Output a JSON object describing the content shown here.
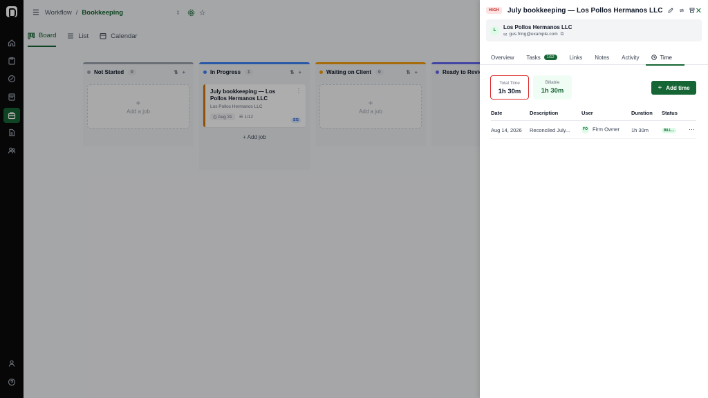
{
  "sidebar": {
    "icons": [
      "logo",
      "home-icon",
      "clipboard-icon",
      "chart-icon",
      "calendar-icon",
      "briefcase-icon",
      "document-icon",
      "users-icon",
      "user-icon",
      "help-icon"
    ]
  },
  "topbar": {
    "section": "Workflow",
    "separator": "/",
    "current": "Bookkeeping"
  },
  "view_tabs": [
    {
      "label": "Board",
      "icon": "board-icon"
    },
    {
      "label": "List",
      "icon": "list-icon"
    },
    {
      "label": "Calendar",
      "icon": "calendar-icon"
    }
  ],
  "columns": [
    {
      "name": "Not Started",
      "count": "0",
      "color": "#9ca3af",
      "add_label": "Add a job"
    },
    {
      "name": "In Progress",
      "count": "1",
      "color": "#3b82f6",
      "add_label": "Add job"
    },
    {
      "name": "Waiting on Client",
      "count": "0",
      "color": "#f59e0b",
      "add_label": "Add a job"
    },
    {
      "name": "Ready to Review",
      "count": "",
      "color": "#6366f1"
    }
  ],
  "card": {
    "title": "July bookkeeping — Los Pollos Hermanos LLC",
    "client": "Los Pollos Hermanos LLC",
    "date": "Aug 31",
    "tasks": "1/12",
    "assignee": "SG"
  },
  "drawer": {
    "priority": "HIGH",
    "title": "July bookkeeping — Los Pollos Hermanos LLC",
    "client": {
      "initial": "L",
      "name": "Los Pollos Hermanos LLC",
      "email": "gus.fring@example.com"
    },
    "tabs": [
      {
        "label": "Overview"
      },
      {
        "label": "Tasks",
        "badge": "1/12"
      },
      {
        "label": "Links"
      },
      {
        "label": "Notes"
      },
      {
        "label": "Activity"
      },
      {
        "label": "Time",
        "active": true
      }
    ],
    "summary": {
      "total_label": "Total Time",
      "total_value": "1h 30m",
      "billable_label": "Billable",
      "billable_value": "1h 30m"
    },
    "add_time_label": "Add time",
    "table": {
      "headers": [
        "Date",
        "Description",
        "User",
        "Duration",
        "Status"
      ],
      "rows": [
        {
          "date": "Aug 14, 2026",
          "description": "Reconciled July...",
          "user_initials": "FO",
          "user": "Firm Owner",
          "duration": "1h 30m",
          "status": "BILL..."
        }
      ]
    }
  },
  "colors": {
    "brand": "#166534",
    "danger": "#dc2626",
    "high": "#b91c1c"
  }
}
